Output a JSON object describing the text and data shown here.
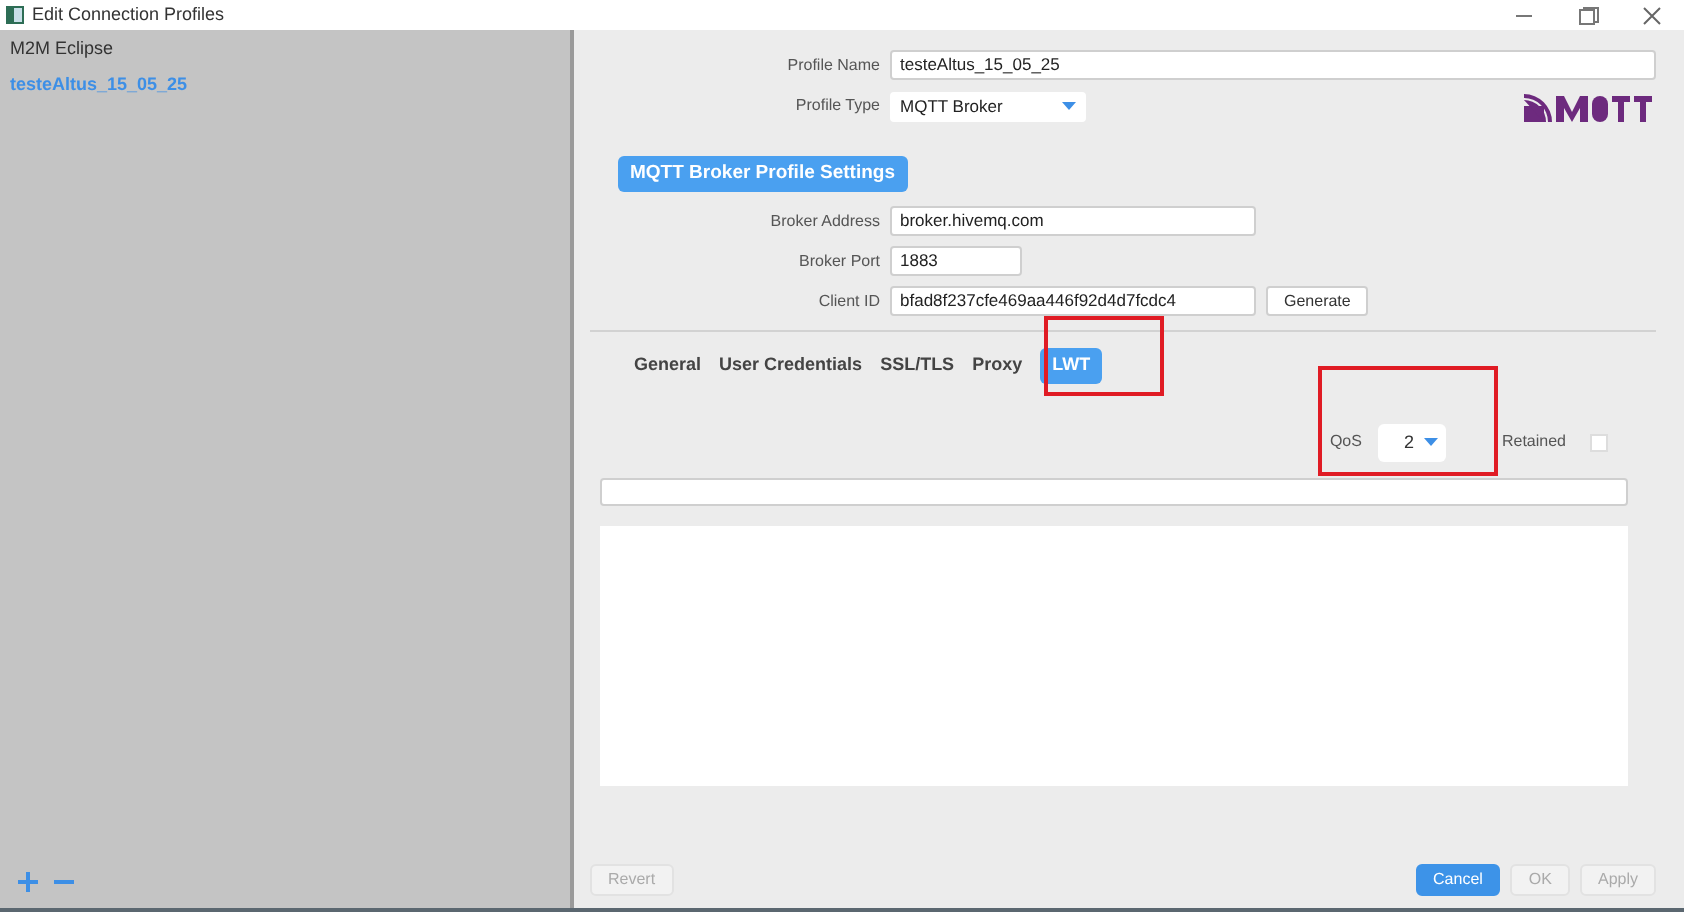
{
  "window": {
    "title": "Edit Connection Profiles"
  },
  "sidebar": {
    "items": [
      {
        "label": "M2M Eclipse",
        "selected": false
      },
      {
        "label": "testeAltus_15_05_25",
        "selected": true
      }
    ]
  },
  "profile": {
    "fields": [
      {
        "label": "Profile Name",
        "value": "testeAltus_15_05_25",
        "kind": "text"
      },
      {
        "label": "Profile Type",
        "value": "MQTT Broker",
        "kind": "select"
      }
    ]
  },
  "section_title": "MQTT Broker Profile Settings",
  "broker": {
    "fields": [
      {
        "label": "Broker Address",
        "value": "broker.hivemq.com",
        "kind": "wide"
      },
      {
        "label": "Broker Port",
        "value": "1883",
        "kind": "narrow"
      },
      {
        "label": "Client ID",
        "value": "bfad8f237cfe469aa446f92d4d7fcdc4",
        "kind": "wide",
        "button": "Generate"
      }
    ]
  },
  "tabs": [
    {
      "label": "General",
      "selected": false
    },
    {
      "label": "User Credentials",
      "selected": false
    },
    {
      "label": "SSL/TLS",
      "selected": false
    },
    {
      "label": "Proxy",
      "selected": false
    },
    {
      "label": "LWT",
      "selected": true
    }
  ],
  "lwt": {
    "qos_label": "QoS",
    "qos_value": "2",
    "retained_label": "Retained",
    "retained_checked": false
  },
  "footer": {
    "buttons": [
      {
        "label": "Revert",
        "kind": "default",
        "disabled": true
      },
      {
        "label": "Cancel",
        "kind": "primary",
        "disabled": false
      },
      {
        "label": "OK",
        "kind": "default",
        "disabled": true
      },
      {
        "label": "Apply",
        "kind": "default",
        "disabled": true
      }
    ]
  }
}
